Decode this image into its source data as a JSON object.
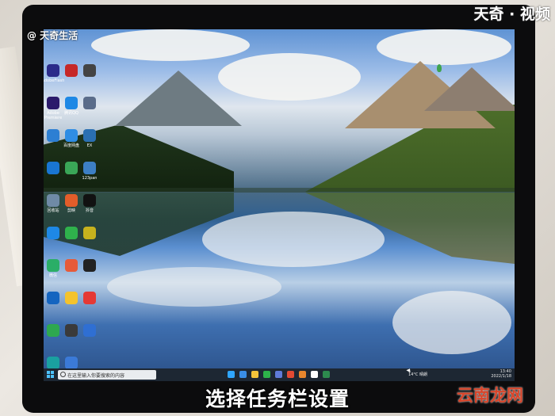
{
  "watermarks": {
    "top_left": "@ 天奇生活",
    "top_right": "天奇 · 视频",
    "bottom_right": "云南龙网"
  },
  "subtitle": "选择任务栏设置",
  "desktop": {
    "icons": [
      {
        "label": "AdobeFlash",
        "color": "#2b2b8a"
      },
      {
        "label": "",
        "color": "#c62828"
      },
      {
        "label": "",
        "color": "#444"
      },
      {
        "label": "Adobe Premiere",
        "color": "#2b1a6b"
      },
      {
        "label": "腾讯QQ",
        "color": "#1e88e5"
      },
      {
        "label": "",
        "color": "#5a6c8a"
      },
      {
        "label": "",
        "color": "#2d7fd3"
      },
      {
        "label": "百度网盘",
        "color": "#2f8de4"
      },
      {
        "label": "EX",
        "color": "#2a6fb2"
      },
      {
        "label": "",
        "color": "#1976d2"
      },
      {
        "label": "",
        "color": "#3aa657"
      },
      {
        "label": "123pan",
        "color": "#3d7fc4"
      },
      {
        "label": "回收站",
        "color": "#6f8aa6"
      },
      {
        "label": "剪映",
        "color": "#e35d2a"
      },
      {
        "label": "抖音",
        "color": "#111"
      },
      {
        "label": "",
        "color": "#1e88e5"
      },
      {
        "label": "",
        "color": "#2fb24c"
      },
      {
        "label": "",
        "color": "#c7b21d"
      },
      {
        "label": "微信",
        "color": "#2aae67"
      },
      {
        "label": "",
        "color": "#e65b3a"
      },
      {
        "label": "",
        "color": "#222"
      },
      {
        "label": "",
        "color": "#1565c0"
      },
      {
        "label": "",
        "color": "#f4c32c"
      },
      {
        "label": "",
        "color": "#e53935"
      },
      {
        "label": "",
        "color": "#2ea84f"
      },
      {
        "label": "",
        "color": "#3a3a3a"
      },
      {
        "label": "",
        "color": "#2f6fd3"
      },
      {
        "label": "Microsoft Edge",
        "color": "#1aa0a0"
      },
      {
        "label": "",
        "color": "#3b7ad8"
      }
    ]
  },
  "taskbar": {
    "search_placeholder": "在这里输入你要搜索的内容",
    "weather": "14°C 晴朗",
    "time": "13:40",
    "date": "2022/1/18",
    "app_colors": [
      "#2fa6ff",
      "#3a8ee6",
      "#f3c33a",
      "#2db14a",
      "#5f7bd8",
      "#e24a33",
      "#e8862d",
      "#ffffff",
      "#2d8a4e"
    ]
  }
}
